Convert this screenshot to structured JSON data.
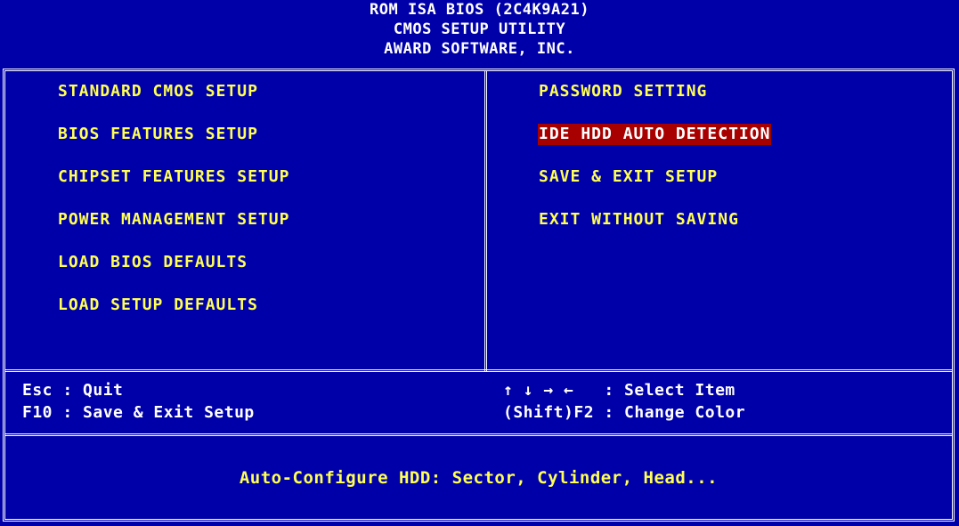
{
  "header": {
    "line1": "ROM ISA  BIOS (2C4K9A21)",
    "line2": "CMOS SETUP UTILITY",
    "line3": "AWARD SOFTWARE, INC."
  },
  "menu": {
    "left": [
      {
        "label": "STANDARD CMOS SETUP"
      },
      {
        "label": "BIOS FEATURES SETUP"
      },
      {
        "label": "CHIPSET FEATURES SETUP"
      },
      {
        "label": "POWER MANAGEMENT SETUP"
      },
      {
        "label": "LOAD BIOS DEFAULTS"
      },
      {
        "label": "LOAD SETUP DEFAULTS"
      }
    ],
    "right": [
      {
        "label": "PASSWORD SETTING"
      },
      {
        "label": "IDE HDD AUTO DETECTION",
        "selected": true
      },
      {
        "label": "SAVE & EXIT SETUP"
      },
      {
        "label": "EXIT WITHOUT SAVING"
      }
    ]
  },
  "help": {
    "esc": "Esc : Quit",
    "f10": "F10 : Save & Exit Setup",
    "arrows": "↑ ↓ → ←   : Select Item",
    "shift_f2": "(Shift)F2 : Change Color"
  },
  "status": {
    "text": "Auto-Configure HDD: Sector, Cylinder, Head..."
  },
  "colors": {
    "background": "#0000a8",
    "menu_text": "#ffff54",
    "selected_bg": "#a80000",
    "selected_text": "#ffffff",
    "frame": "#ffffff"
  }
}
